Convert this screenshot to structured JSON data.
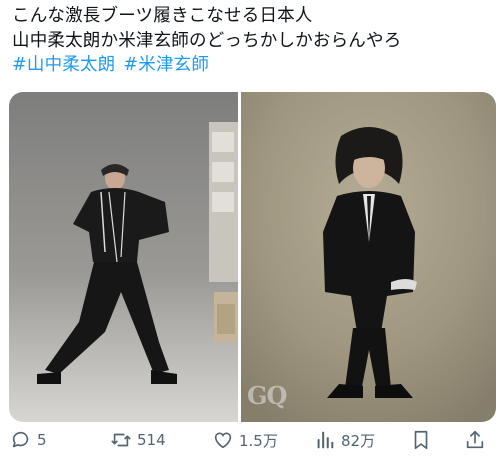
{
  "tweet": {
    "lines": [
      "こんな激長ブーツ履きこなせる日本人",
      "山中柔太朗か米津玄師のどっちかしかおらんやろ"
    ],
    "hashtags": [
      "#山中柔太朗",
      "#米津玄師"
    ]
  },
  "media": {
    "watermark": "GQ"
  },
  "actions": {
    "replies": "5",
    "retweets": "514",
    "likes": "1.5万",
    "views": "82万"
  },
  "icons": {
    "reply": "reply-icon",
    "retweet": "retweet-icon",
    "like": "heart-icon",
    "views": "views-chart-icon",
    "bookmark": "bookmark-icon",
    "share": "share-icon"
  },
  "colors": {
    "text": "#0f1419",
    "hashtag": "#1d9bf0",
    "muted": "#536471"
  }
}
